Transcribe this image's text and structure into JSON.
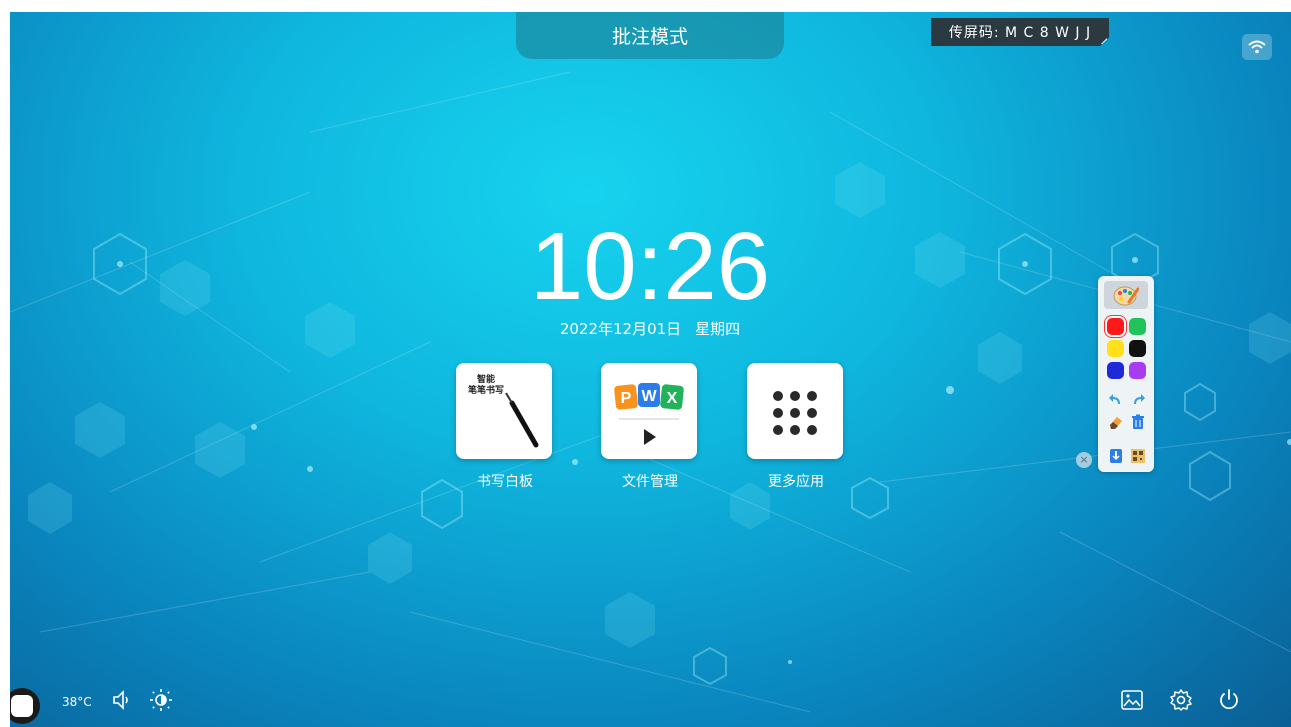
{
  "header": {
    "mode_title": "批注模式",
    "cast_code": "传屏码: M C 8 W J J"
  },
  "clock": {
    "time": "10:26",
    "date": "2022年12月01日",
    "weekday": "星期四"
  },
  "apps": [
    {
      "label": "书写白板",
      "icon": "smart-pen-icon",
      "icon_text": "智能\n笔笔书写"
    },
    {
      "label": "文件管理",
      "icon": "file-manager-icon",
      "badges": [
        "P",
        "W",
        "X"
      ]
    },
    {
      "label": "更多应用",
      "icon": "grid-dots-icon"
    }
  ],
  "annotation_toolbar": {
    "colors": [
      "#ff1a1a",
      "#22c35a",
      "#ffe01a",
      "#111111",
      "#1e2ad8",
      "#a83cf0"
    ],
    "selected_color": "#ff1a1a",
    "tools": [
      "palette-icon",
      "undo-icon",
      "redo-icon",
      "eraser-icon",
      "trash-icon",
      "download-icon",
      "qr-code-icon"
    ],
    "close_label": "×"
  },
  "status_bar": {
    "temperature": "38°C",
    "icons": [
      "home-icon",
      "volume-icon",
      "brightness-icon",
      "gallery-icon",
      "settings-icon",
      "power-icon",
      "wifi-icon"
    ]
  }
}
